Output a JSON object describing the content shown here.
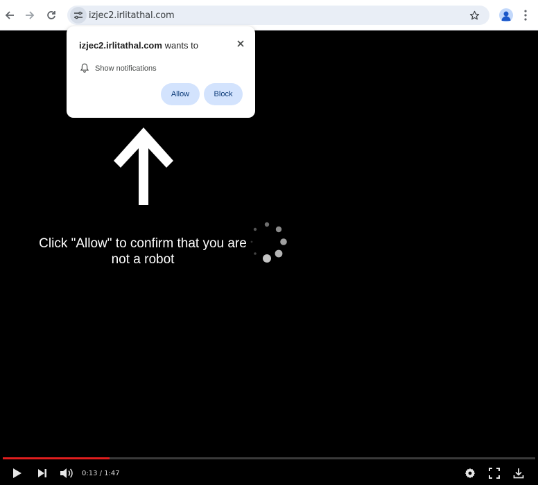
{
  "browser": {
    "url": "izjec2.irlitathal.com",
    "icons": [
      "back-arrow-icon",
      "forward-arrow-icon",
      "reload-icon",
      "site-info-icon",
      "bookmark-star-icon",
      "profile-icon",
      "more-menu-icon"
    ]
  },
  "popup": {
    "site": "izjec2.irlitathal.com",
    "wants_to": "wants to",
    "permission": "Show notifications",
    "allow_label": "Allow",
    "block_label": "Block",
    "icons": [
      "close-icon",
      "bell-icon"
    ]
  },
  "page": {
    "message": "Click \"Allow\" to confirm that you are not a robot"
  },
  "player": {
    "time": "0:13 / 1:47",
    "progress": 0.2,
    "icons": [
      "play-icon",
      "next-icon",
      "volume-icon",
      "settings-icon",
      "fullscreen-icon",
      "download-icon"
    ]
  },
  "colors": {
    "accent": "#d3e3fd",
    "progress": "#e01e1e",
    "background": "#000000"
  }
}
